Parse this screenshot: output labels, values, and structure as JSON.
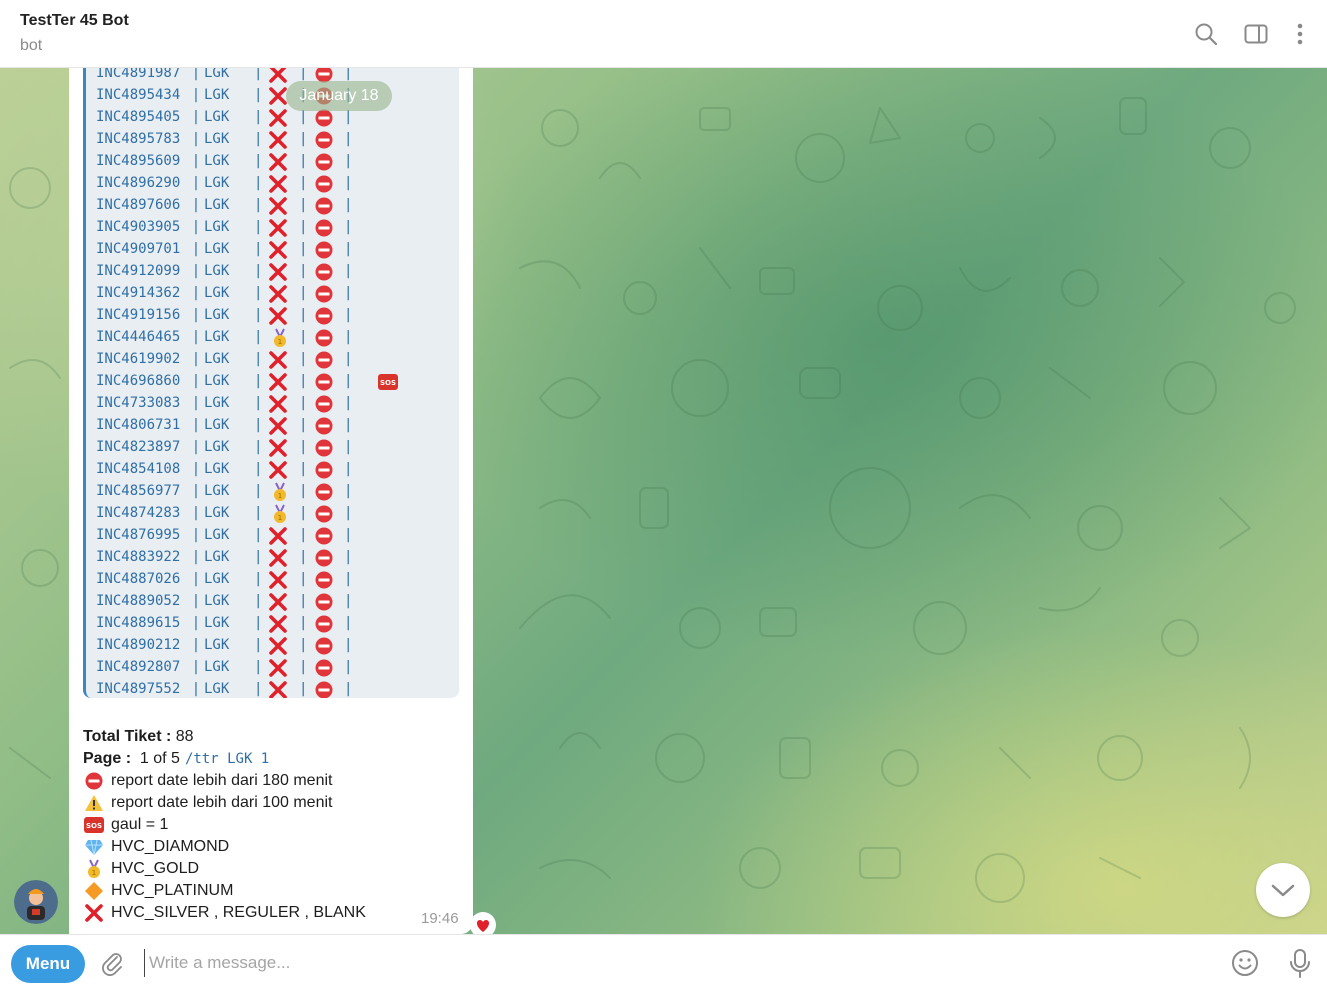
{
  "header": {
    "title": "TestTer 45 Bot",
    "subtitle": "bot"
  },
  "chat": {
    "date_pill": "January 18",
    "separator": "|",
    "tickets": [
      {
        "id": "INC4891987",
        "site": "LGK",
        "tier": "silver",
        "status": "stop",
        "sos": false
      },
      {
        "id": "INC4895434",
        "site": "LGK",
        "tier": "silver",
        "status": "stop",
        "sos": false
      },
      {
        "id": "INC4895405",
        "site": "LGK",
        "tier": "silver",
        "status": "stop",
        "sos": false
      },
      {
        "id": "INC4895783",
        "site": "LGK",
        "tier": "silver",
        "status": "stop",
        "sos": false
      },
      {
        "id": "INC4895609",
        "site": "LGK",
        "tier": "silver",
        "status": "stop",
        "sos": false
      },
      {
        "id": "INC4896290",
        "site": "LGK",
        "tier": "silver",
        "status": "stop",
        "sos": false
      },
      {
        "id": "INC4897606",
        "site": "LGK",
        "tier": "silver",
        "status": "stop",
        "sos": false
      },
      {
        "id": "INC4903905",
        "site": "LGK",
        "tier": "silver",
        "status": "stop",
        "sos": false
      },
      {
        "id": "INC4909701",
        "site": "LGK",
        "tier": "silver",
        "status": "stop",
        "sos": false
      },
      {
        "id": "INC4912099",
        "site": "LGK",
        "tier": "silver",
        "status": "stop",
        "sos": false
      },
      {
        "id": "INC4914362",
        "site": "LGK",
        "tier": "silver",
        "status": "stop",
        "sos": false
      },
      {
        "id": "INC4919156",
        "site": "LGK",
        "tier": "silver",
        "status": "stop",
        "sos": false
      },
      {
        "id": "INC4446465",
        "site": "LGK",
        "tier": "gold",
        "status": "stop",
        "sos": false
      },
      {
        "id": "INC4619902",
        "site": "LGK",
        "tier": "silver",
        "status": "stop",
        "sos": false
      },
      {
        "id": "INC4696860",
        "site": "LGK",
        "tier": "silver",
        "status": "stop",
        "sos": true
      },
      {
        "id": "INC4733083",
        "site": "LGK",
        "tier": "silver",
        "status": "stop",
        "sos": false
      },
      {
        "id": "INC4806731",
        "site": "LGK",
        "tier": "silver",
        "status": "stop",
        "sos": false
      },
      {
        "id": "INC4823897",
        "site": "LGK",
        "tier": "silver",
        "status": "stop",
        "sos": false
      },
      {
        "id": "INC4854108",
        "site": "LGK",
        "tier": "silver",
        "status": "stop",
        "sos": false
      },
      {
        "id": "INC4856977",
        "site": "LGK",
        "tier": "gold",
        "status": "stop",
        "sos": false
      },
      {
        "id": "INC4874283",
        "site": "LGK",
        "tier": "gold",
        "status": "stop",
        "sos": false
      },
      {
        "id": "INC4876995",
        "site": "LGK",
        "tier": "silver",
        "status": "stop",
        "sos": false
      },
      {
        "id": "INC4883922",
        "site": "LGK",
        "tier": "silver",
        "status": "stop",
        "sos": false
      },
      {
        "id": "INC4887026",
        "site": "LGK",
        "tier": "silver",
        "status": "stop",
        "sos": false
      },
      {
        "id": "INC4889052",
        "site": "LGK",
        "tier": "silver",
        "status": "stop",
        "sos": false
      },
      {
        "id": "INC4889615",
        "site": "LGK",
        "tier": "silver",
        "status": "stop",
        "sos": false
      },
      {
        "id": "INC4890212",
        "site": "LGK",
        "tier": "silver",
        "status": "stop",
        "sos": false
      },
      {
        "id": "INC4892807",
        "site": "LGK",
        "tier": "silver",
        "status": "stop",
        "sos": false
      },
      {
        "id": "INC4897552",
        "site": "LGK",
        "tier": "silver",
        "status": "stop",
        "sos": false
      }
    ],
    "summary": {
      "total_label": "Total Tiket :",
      "total_value": "88",
      "page_label": "Page :",
      "page_value": "1 of 5",
      "page_command": "/ttr LGK 1",
      "legend": [
        {
          "icon": "stop-icon",
          "text": "report date lebih dari 180 menit"
        },
        {
          "icon": "warning-icon",
          "text": "report date lebih dari 100 menit"
        },
        {
          "icon": "sos-icon",
          "text": "gaul = 1"
        },
        {
          "icon": "diamond-icon",
          "text": "HVC_DIAMOND"
        },
        {
          "icon": "gold-medal-icon",
          "text": "HVC_GOLD"
        },
        {
          "icon": "orange-diamond-icon",
          "text": "HVC_PLATINUM"
        },
        {
          "icon": "red-x-icon",
          "text": "HVC_SILVER , REGULER , BLANK"
        }
      ]
    },
    "time": "19:46",
    "reaction": "heart-icon",
    "sos_text": "SOS"
  },
  "footer": {
    "menu_label": "Menu",
    "input_placeholder": "Write a message..."
  },
  "colors": {
    "accent": "#3a9ce0",
    "code_text": "#2f6fa6",
    "code_bg": "#e9eef2",
    "red_x": "#e0202a",
    "stop_red": "#e0353b"
  }
}
